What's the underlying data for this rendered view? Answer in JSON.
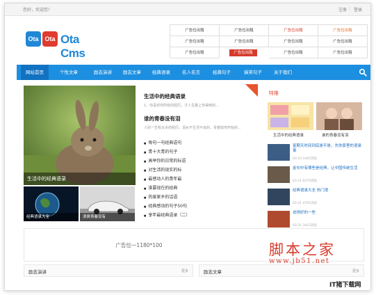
{
  "topbar": {
    "welcome": "您好，欢迎您！",
    "login": "注册",
    "register": "登录",
    "sep": "|"
  },
  "logo": {
    "box1": "Ota",
    "box2": "Ota",
    "text": "Ota Cms"
  },
  "ads": [
    [
      "广告位出租",
      "广告位出租",
      "广告位出租",
      "广告位出租"
    ],
    [
      "广告位出租",
      "广告位出租",
      "广告位出租",
      "广告位出租"
    ],
    [
      "广告位出租",
      "广告位出租",
      "广告位出租",
      "广告位出租"
    ]
  ],
  "ad_colors": [
    [
      "#444444",
      "#444444",
      "#d63a2c",
      "#e0702c"
    ],
    [
      "#444444",
      "#444444",
      "#444444",
      "#444444"
    ],
    [
      "#444444",
      "#d63a2c",
      "#444444",
      "#444444"
    ]
  ],
  "nav": {
    "items": [
      "网站首页",
      "个性文章",
      "励志演讲",
      "励志文章",
      "经典语录",
      "名人名言",
      "经典句子",
      "搞笑句子",
      "关于我们"
    ]
  },
  "hero": {
    "caption": "生活中的经典语录"
  },
  "thumbs": [
    {
      "caption": "经典语录大全"
    },
    {
      "caption": "浪费青春没有"
    }
  ],
  "mid": {
    "h1": "生活中的经典语录",
    "s1": "1、你喜欢你所有的经历，才人生路上你得到的...",
    "h2": "谁的青春没有泪",
    "s2": "人的一生有太多的经历，泪水不生活不会的，青春如何开始的...",
    "list": [
      "每句一句经典语句",
      "青十大青的句子",
      "高举你的日常的标语",
      "对生活的现实的标",
      "最感动人的青年最",
      "谁要现在的经典",
      "热爱家乡的话语",
      "经典感动的句子50句",
      "享年最经典语录（二）"
    ]
  },
  "right": {
    "title": "特推",
    "tags": [
      {
        "caption": "生活中的经典语录"
      },
      {
        "caption": "谁的青春没有泪"
      }
    ],
    "items": [
      {
        "title": "星期天时间到底是不是，先你家里的语录事",
        "meta": "03-23  1405浏览"
      },
      {
        "title": "金句中有哪些是经典，让中国传统生活",
        "meta": "03-21  6270浏览"
      },
      {
        "title": "经典语录大全 热门语",
        "meta": "03-21  4761浏览"
      },
      {
        "title": "说得好的一些",
        "meta": "03-21  3412浏览"
      }
    ]
  },
  "banner": {
    "text": "广告位一1180*100"
  },
  "sections": [
    {
      "title": "励志演讲",
      "more": "更多"
    },
    {
      "title": "励志文章",
      "more": "更多"
    }
  ],
  "watermark": {
    "line1": "脚本之家",
    "line2": "www.jb51.net",
    "corner": "IT猪下载网"
  },
  "colors": {
    "nav": "#1d8fe0",
    "nav_active": "#1272c2",
    "logo_blue": "#1f87d6",
    "logo_red": "#e03b2f",
    "accent_red": "#d63a2c"
  }
}
